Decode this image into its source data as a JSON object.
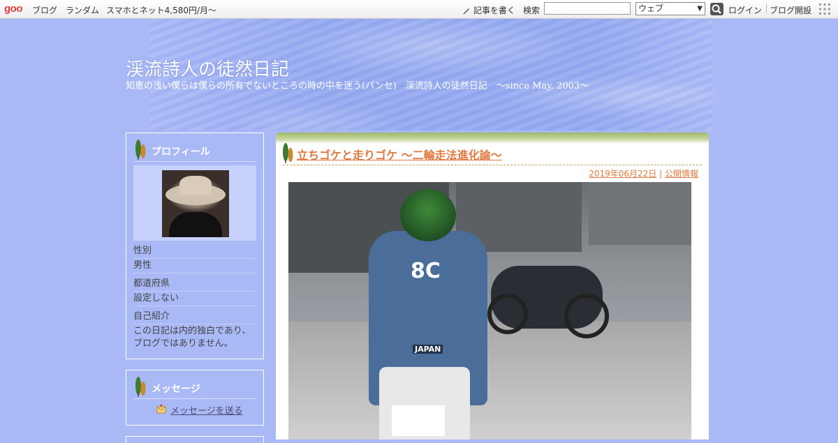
{
  "topbar": {
    "logo": "goo",
    "nav": [
      "ブログ",
      "ランダム",
      "スマホとネット4,580円/月～"
    ],
    "post_link": "記事を書く",
    "search_label": "検索",
    "search_value": "",
    "search_select": "ウェブ",
    "login": "ログイン",
    "open_blog": "ブログ開設"
  },
  "header": {
    "title": "渓流詩人の徒然日記",
    "subtitle": "知恵の浅い僕らは僕らの所有でないところの時の中を迷う(パンセ)　渓流詩人の徒然日記　～since May, 2003～"
  },
  "sidebar": {
    "profile": {
      "heading": "プロフィール",
      "rows": [
        {
          "label": "性別",
          "value": "男性"
        },
        {
          "label": "都道府県",
          "value": "設定しない"
        },
        {
          "label": "自己紹介",
          "value": "この日記は内的独白であり、ブログではありません。"
        }
      ]
    },
    "message": {
      "heading": "メッセージ",
      "link": "メッセージを送る"
    }
  },
  "post": {
    "title": "立ちゴケと走りゴケ ～二輪走法進化論～",
    "date": "2019年06月22日",
    "separator": "|",
    "visibility": "公開情報",
    "photo_text_back": "8C",
    "photo_text_patch": "JAPAN"
  },
  "colors": {
    "background": "#a9b9f6",
    "title_orange": "#e27a3f",
    "logo_red": "#e23c3c"
  }
}
